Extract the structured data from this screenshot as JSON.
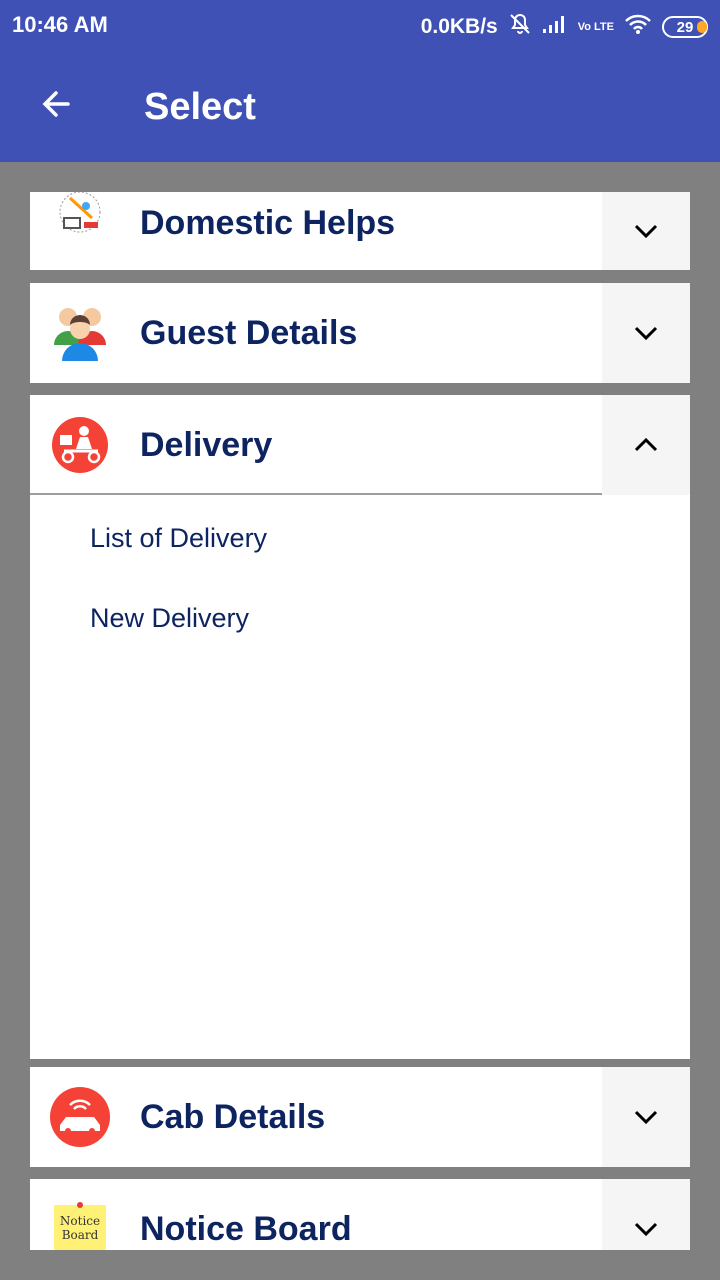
{
  "status_bar": {
    "time": "10:46 AM",
    "network_speed": "0.0KB/s",
    "lte_label": "Vo LTE",
    "battery": "29",
    "icons": [
      "mute-bell-icon",
      "signal-icon",
      "wifi-icon",
      "battery-icon"
    ]
  },
  "toolbar": {
    "title": "Select",
    "back_icon": "arrow-left-icon"
  },
  "menu": {
    "items": [
      {
        "label": "Domestic Helps",
        "icon": "domestic-help-icon",
        "expanded": false
      },
      {
        "label": "Guest Details",
        "icon": "guests-icon",
        "expanded": false
      },
      {
        "label": "Delivery",
        "icon": "delivery-scooter-icon",
        "expanded": true,
        "sub_items": [
          {
            "label": "List of Delivery"
          },
          {
            "label": "New Delivery"
          }
        ]
      },
      {
        "label": "Cab Details",
        "icon": "cab-icon",
        "expanded": false
      },
      {
        "label": "Notice Board",
        "icon": "notice-board-icon",
        "expanded": false,
        "icon_text": "Notice Board"
      }
    ]
  },
  "colors": {
    "primary": "#3f51b5",
    "text_dark_blue": "#0d2460",
    "background": "#808080",
    "chevron_bg": "#f5f5f5",
    "icon_red": "#f44336"
  }
}
